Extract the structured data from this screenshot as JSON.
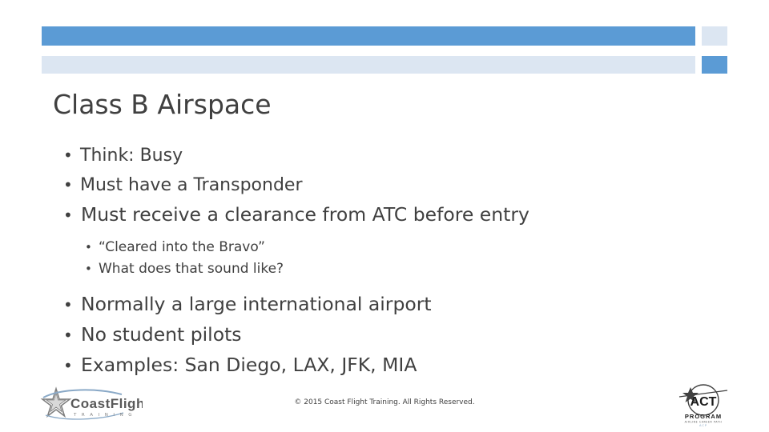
{
  "slide": {
    "title": "Class B Airspace",
    "footer": "© 2015 Coast Flight Training. All Rights Reserved.",
    "bullets": [
      {
        "level": 1,
        "marker": "•",
        "text": "Think: Busy"
      },
      {
        "level": 1,
        "marker": "•",
        "text": "Must have a Transponder"
      },
      {
        "level": 1,
        "marker": "•",
        "text": "Must receive a clearance from ATC before entry"
      },
      {
        "level": 2,
        "marker": "•",
        "text": "“Cleared into the Bravo”"
      },
      {
        "level": 2,
        "marker": "•",
        "text": "What does that sound like?"
      },
      {
        "level": 1,
        "marker": "•",
        "text": "Normally a large international airport"
      },
      {
        "level": 1,
        "marker": "•",
        "text": "No student pilots"
      },
      {
        "level": 1,
        "marker": "•",
        "text": "Examples: San Diego, LAX, JFK, MIA"
      }
    ]
  },
  "logos": {
    "left": {
      "name": "Coast Flight Training",
      "wordmark": "CoastFlight",
      "tagline": "T R A I N I N G"
    },
    "right": {
      "name": "ACT Program",
      "wordmark": "ACT",
      "line1": "PROGRAM",
      "line2": "AIRLINE CAREER PATH",
      "line3": "ACP"
    }
  },
  "colors": {
    "accent": "#5b9bd5",
    "accent_light": "#dce6f2",
    "text": "#404040"
  }
}
